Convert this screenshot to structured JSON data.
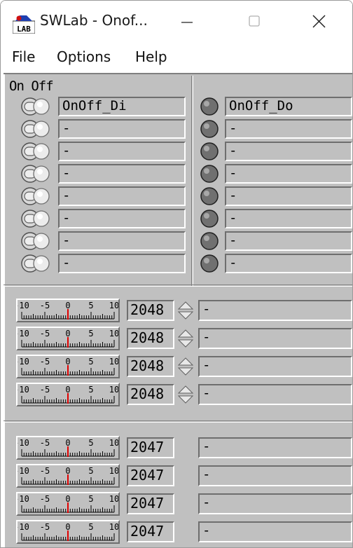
{
  "window": {
    "title": "SWLab - Onof...",
    "icon_label": "LAB",
    "controls": [
      "minimize-icon",
      "maximize-icon",
      "close-icon"
    ]
  },
  "menu": {
    "items": [
      "File",
      "Options",
      "Help"
    ]
  },
  "onoff": {
    "group_label": "On Off",
    "inputs": [
      "OnOff_Di",
      "-",
      "-",
      "-",
      "-",
      "-",
      "-",
      "-"
    ],
    "outputs": [
      "OnOff_Do",
      "-",
      "-",
      "-",
      "-",
      "-",
      "-",
      "-"
    ]
  },
  "analog_in": {
    "scale_labels": [
      "-10",
      "-5",
      "0",
      "5",
      "10"
    ],
    "rows": [
      {
        "value": "2048",
        "name": "-"
      },
      {
        "value": "2048",
        "name": "-"
      },
      {
        "value": "2048",
        "name": "-"
      },
      {
        "value": "2048",
        "name": "-"
      }
    ]
  },
  "analog_out": {
    "scale_labels": [
      "-10",
      "-5",
      "0",
      "5",
      "10"
    ],
    "rows": [
      {
        "value": "2047",
        "name": "-"
      },
      {
        "value": "2047",
        "name": "-"
      },
      {
        "value": "2047",
        "name": "-"
      },
      {
        "value": "2047",
        "name": "-"
      }
    ]
  },
  "colors": {
    "panel": "#c0c0c0",
    "needle": "#e00000",
    "led_off": "#707070"
  }
}
